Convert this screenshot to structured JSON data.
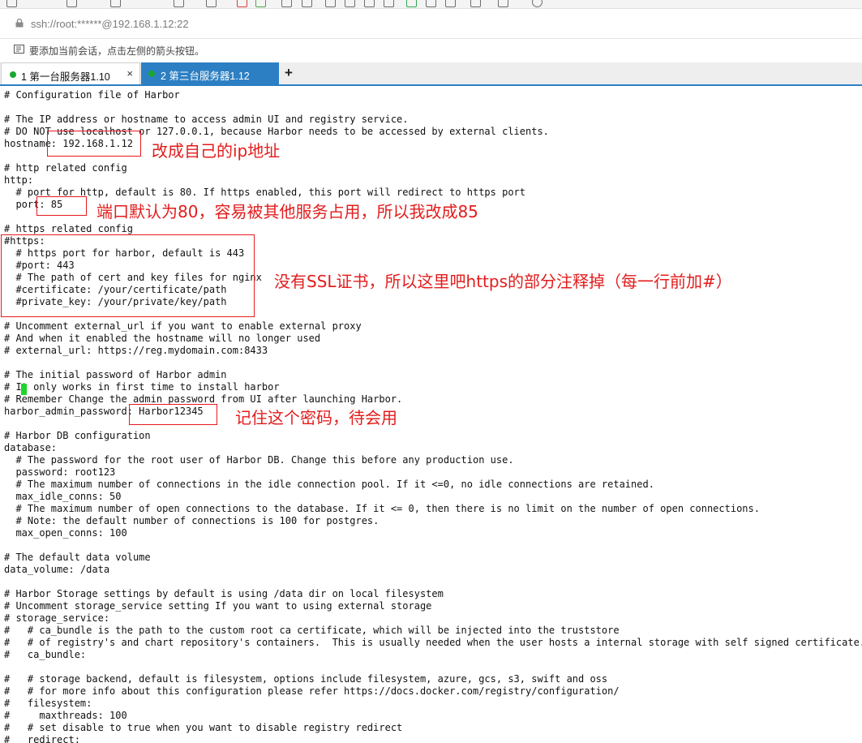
{
  "address": {
    "url": "ssh://root:******@192.168.1.12:22"
  },
  "hint": {
    "text": "要添加当前会话，点击左侧的箭头按钮。"
  },
  "tabs": [
    {
      "label": "1 第一台服务器1.10",
      "close": "×",
      "status_color": "#1aa732",
      "active": false
    },
    {
      "label": "2 第三台服务器1.12",
      "close": "×",
      "status_color": "#1aa732",
      "active": true
    }
  ],
  "new_tab": "+",
  "terminal": {
    "lines": [
      "# Configuration file of Harbor",
      "",
      "# The IP address or hostname to access admin UI and registry service.",
      "# DO NOT use localhost or 127.0.0.1, because Harbor needs to be accessed by external clients.",
      "hostname: 192.168.1.12",
      "",
      "# http related config",
      "http:",
      "  # port for http, default is 80. If https enabled, this port will redirect to https port",
      "  port: 85",
      "",
      "# https related config",
      "#https:",
      "  # https port for harbor, default is 443",
      "  #port: 443",
      "  # The path of cert and key files for nginx",
      "  #certificate: /your/certificate/path",
      "  #private_key: /your/private/key/path",
      "",
      "# Uncomment external_url if you want to enable external proxy",
      "# And when it enabled the hostname will no longer used",
      "# external_url: https://reg.mydomain.com:8433",
      "",
      "# The initial password of Harbor admin",
      "# It only works in first time to install harbor",
      "# Remember Change the admin password from UI after launching Harbor.",
      "harbor_admin_password: Harbor12345",
      "",
      "# Harbor DB configuration",
      "database:",
      "  # The password for the root user of Harbor DB. Change this before any production use.",
      "  password: root123",
      "  # The maximum number of connections in the idle connection pool. If it <=0, no idle connections are retained.",
      "  max_idle_conns: 50",
      "  # The maximum number of open connections to the database. If it <= 0, then there is no limit on the number of open connections.",
      "  # Note: the default number of connections is 100 for postgres.",
      "  max_open_conns: 100",
      "",
      "# The default data volume",
      "data_volume: /data",
      "",
      "# Harbor Storage settings by default is using /data dir on local filesystem",
      "# Uncomment storage_service setting If you want to using external storage",
      "# storage_service:",
      "#   # ca_bundle is the path to the custom root ca certificate, which will be injected into the truststore",
      "#   # of registry's and chart repository's containers.  This is usually needed when the user hosts a internal storage with self signed certificate.",
      "#   ca_bundle:",
      "",
      "#   # storage backend, default is filesystem, options include filesystem, azure, gcs, s3, swift and oss",
      "#   # for more info about this configuration please refer https://docs.docker.com/registry/configuration/",
      "#   filesystem:",
      "#     maxthreads: 100",
      "#   # set disable to true when you want to disable registry redirect",
      "#   redirect:"
    ]
  },
  "annotations": {
    "hostname_note": "改成自己的ip地址",
    "port_note": "端口默认为80，容易被其他服务占用，所以我改成85",
    "https_note": "没有SSL证书，所以这里吧https的部分注释掉（每一行前加#）",
    "password_note": "记住这个密码，待会用",
    "color": "#e31c1c"
  }
}
